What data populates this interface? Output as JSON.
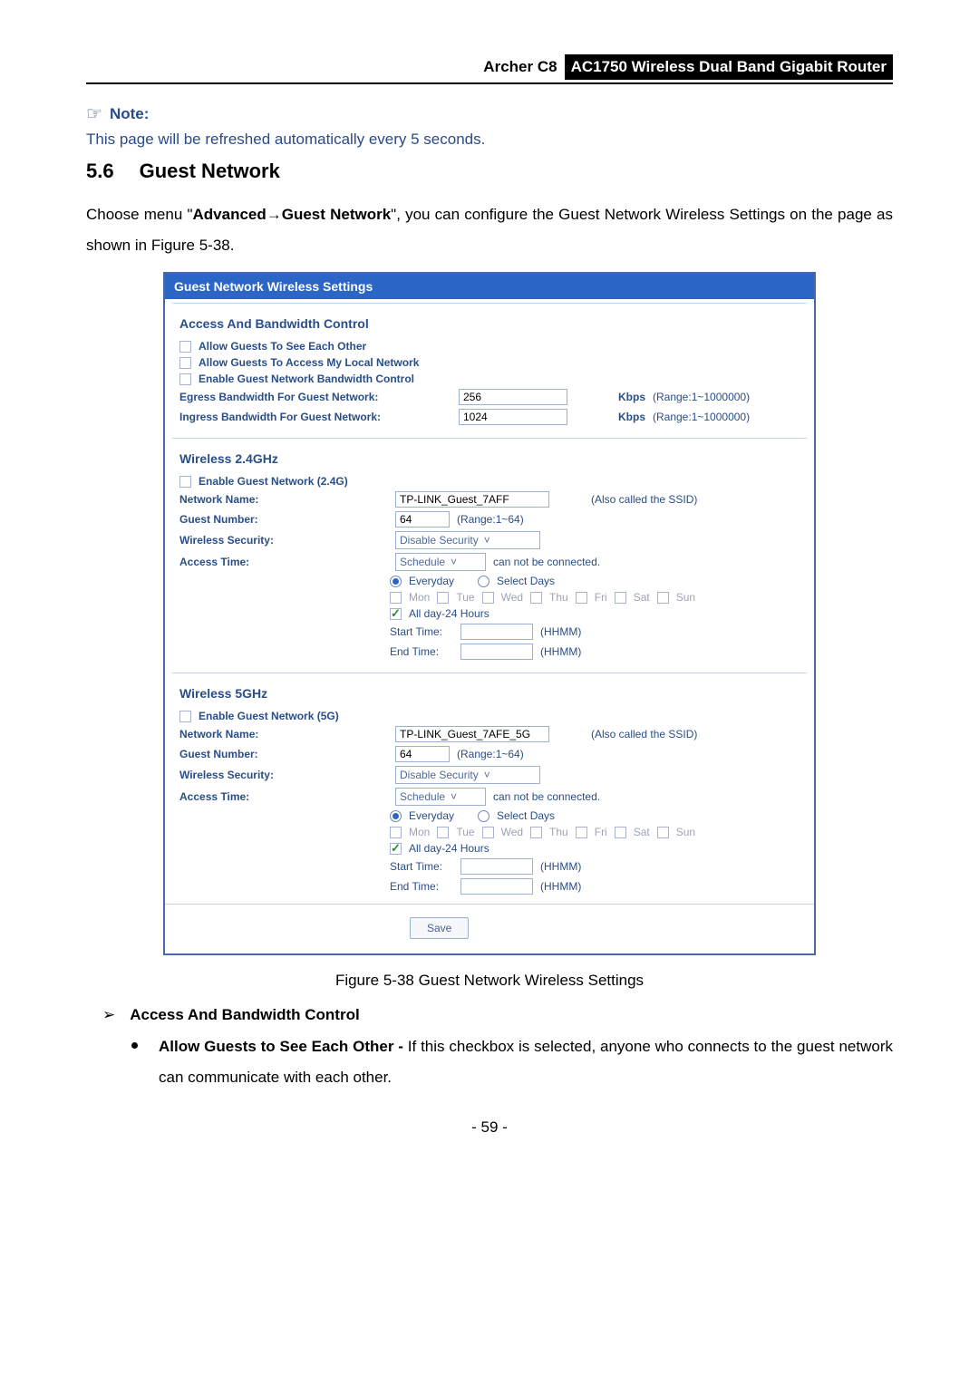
{
  "header": {
    "product": "Archer C8",
    "model": "AC1750 Wireless Dual Band Gigabit Router"
  },
  "note": {
    "label": "Note:",
    "body": "This page will be refreshed automatically every 5 seconds."
  },
  "section": {
    "num": "5.6",
    "title": "Guest Network"
  },
  "intro_a": "Choose menu \"",
  "intro_b": "Advanced",
  "intro_arrow": "→",
  "intro_c": "Guest Network",
  "intro_d": "\", you can configure the Guest Network Wireless Settings on the page as shown in Figure 5-38.",
  "panel": {
    "title": "Guest Network Wireless Settings",
    "access": {
      "title": "Access And Bandwidth Control",
      "opt_see": "Allow Guests To See Each Other",
      "opt_local": "Allow Guests To Access My Local Network",
      "opt_bw": "Enable Guest Network Bandwidth Control",
      "egress_label": "Egress Bandwidth For Guest Network:",
      "egress_value": "256",
      "ingress_label": "Ingress Bandwidth For Guest Network:",
      "ingress_value": "1024",
      "kbps": "Kbps",
      "range": "(Range:1~1000000)"
    },
    "wl24": {
      "title": "Wireless 2.4GHz",
      "enable": "Enable Guest Network (2.4G)",
      "name_label": "Network Name:",
      "name_value": "TP-LINK_Guest_7AFF",
      "ssid_note": "(Also called the SSID)",
      "guestno_label": "Guest Number:",
      "guestno_value": "64",
      "guestno_range": "(Range:1~64)",
      "sec_label": "Wireless Security:",
      "sec_value": "Disable Security",
      "access_label": "Access Time:",
      "access_value": "Schedule",
      "access_note": "can not be connected.",
      "everyday": "Everyday",
      "selectdays": "Select Days",
      "days": {
        "mon": "Mon",
        "tue": "Tue",
        "wed": "Wed",
        "thu": "Thu",
        "fri": "Fri",
        "sat": "Sat",
        "sun": "Sun"
      },
      "allday": "All day-24 Hours",
      "start": "Start Time:",
      "end": "End Time:",
      "fmt": "(HHMM)"
    },
    "wl5": {
      "title": "Wireless 5GHz",
      "enable": "Enable Guest Network (5G)",
      "name_label": "Network Name:",
      "name_value": "TP-LINK_Guest_7AFE_5G",
      "ssid_note": "(Also called the SSID)",
      "guestno_label": "Guest Number:",
      "guestno_value": "64",
      "guestno_range": "(Range:1~64)",
      "sec_label": "Wireless Security:",
      "sec_value": "Disable Security",
      "access_label": "Access Time:",
      "access_value": "Schedule",
      "access_note": "can not be connected.",
      "everyday": "Everyday",
      "selectdays": "Select Days",
      "days": {
        "mon": "Mon",
        "tue": "Tue",
        "wed": "Wed",
        "thu": "Thu",
        "fri": "Fri",
        "sat": "Sat",
        "sun": "Sun"
      },
      "allday": "All day-24 Hours",
      "start": "Start Time:",
      "end": "End Time:",
      "fmt": "(HHMM)"
    },
    "save": "Save"
  },
  "caption": "Figure 5-38 Guest Network Wireless Settings",
  "b1": "Access And Bandwidth Control",
  "b2_lead": "Allow Guests to See Each Other - ",
  "b2_rest": "If this checkbox is selected, anyone who connects to the guest network can communicate with each other.",
  "pagenum": "- 59 -"
}
